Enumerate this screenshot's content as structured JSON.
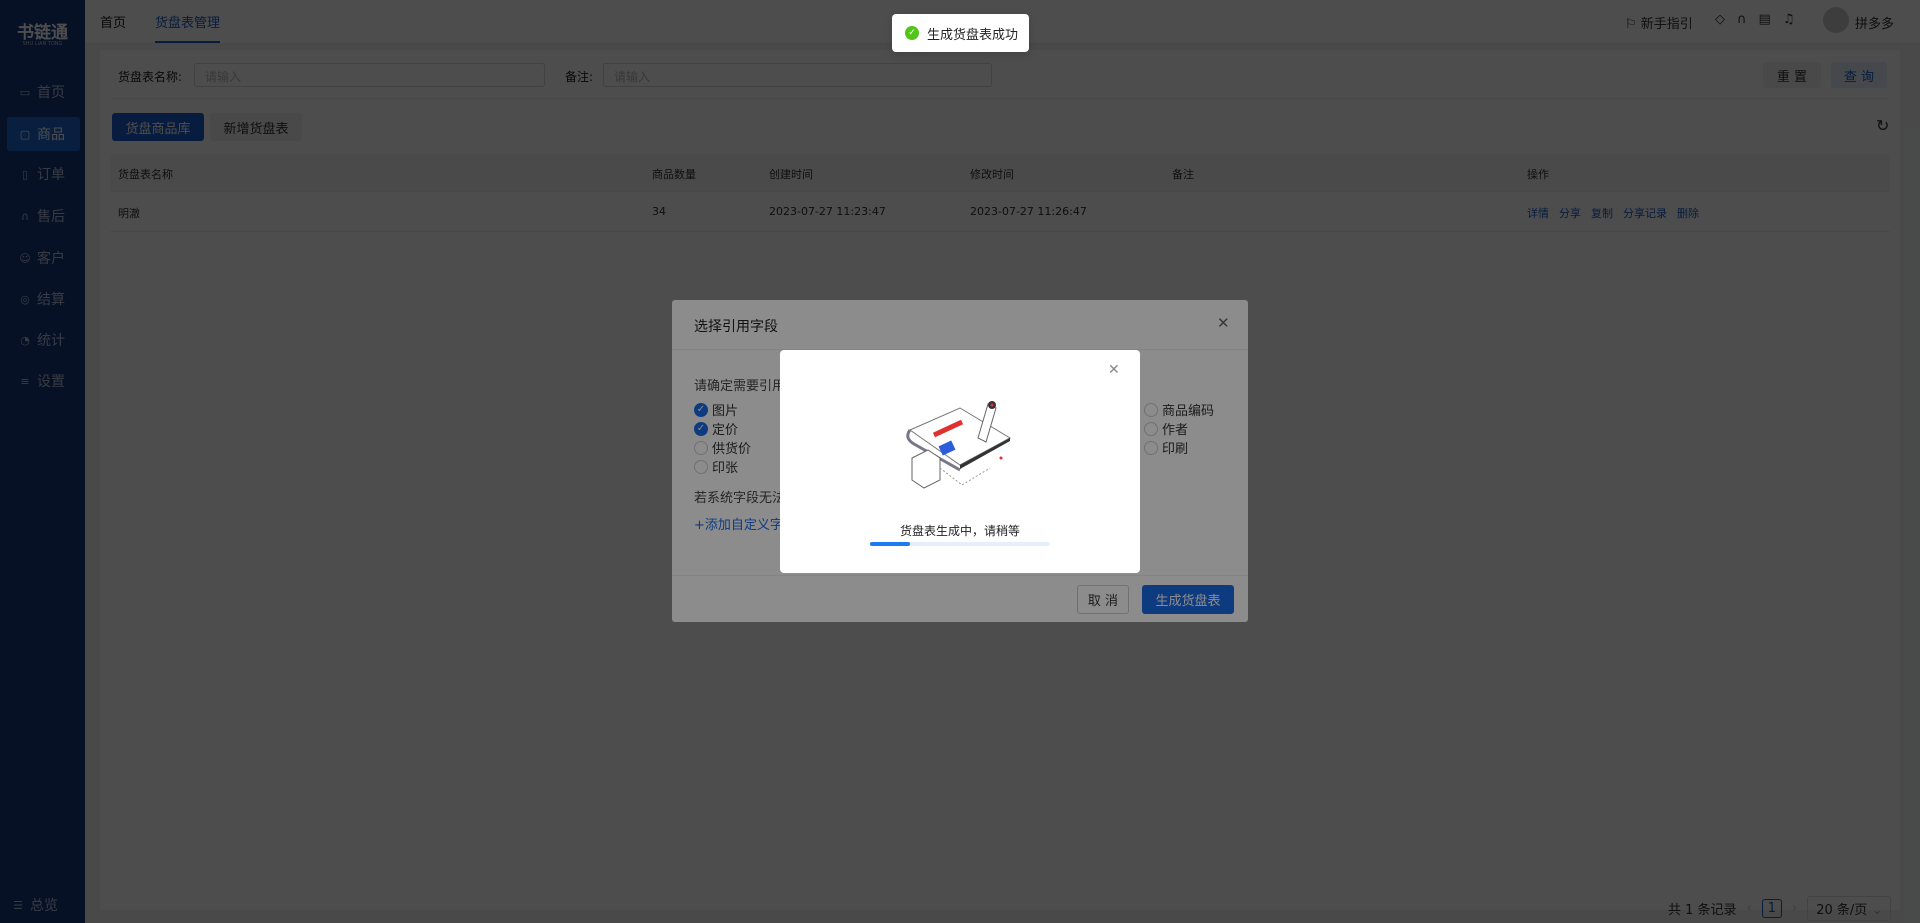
{
  "app": {
    "logo": "书链通",
    "logo_sub": "SHU LIAN TONG"
  },
  "sidebar": {
    "items": [
      {
        "label": "首页",
        "icon": "monitor-icon"
      },
      {
        "label": "商品",
        "icon": "box-icon",
        "active": true
      },
      {
        "label": "订单",
        "icon": "document-icon"
      },
      {
        "label": "售后",
        "icon": "headset-icon"
      },
      {
        "label": "客户",
        "icon": "users-icon"
      },
      {
        "label": "结算",
        "icon": "settle-icon"
      },
      {
        "label": "统计",
        "icon": "pie-icon"
      },
      {
        "label": "设置",
        "icon": "sliders-icon"
      }
    ],
    "footer": "总览"
  },
  "header": {
    "tabs": [
      "首页",
      "货盘表管理"
    ],
    "active_tab": 1,
    "guide": "新手指引",
    "user": "拼多多"
  },
  "search": {
    "name_label": "货盘表名称:",
    "name_placeholder": "请输入",
    "note_label": "备注:",
    "note_placeholder": "请输入",
    "reset": "重 置",
    "query": "查 询"
  },
  "toolbar": {
    "library": "货盘商品库",
    "add": "新增货盘表"
  },
  "table": {
    "columns": [
      "货盘表名称",
      "商品数量",
      "创建时间",
      "修改时间",
      "备注",
      "操作"
    ],
    "rows": [
      {
        "name": "明澈",
        "count": "34",
        "created": "2023-07-27 11:23:47",
        "modified": "2023-07-27 11:26:47",
        "note": "",
        "actions": [
          "详情",
          "分享",
          "复制",
          "分享记录",
          "删除"
        ]
      }
    ]
  },
  "pagination": {
    "total": "共 1 条记录",
    "page": "1",
    "page_size": "20 条/页"
  },
  "dialog": {
    "title": "选择引用字段",
    "prompt": "请确定需要引用",
    "fields_left": [
      {
        "label": "图片",
        "checked": true
      },
      {
        "label": "定价",
        "checked": true
      },
      {
        "label": "供货价",
        "checked": false
      },
      {
        "label": "印张",
        "checked": false
      }
    ],
    "fields_right": [
      {
        "label": "商品编码",
        "checked": false
      },
      {
        "label": "作者",
        "checked": false
      },
      {
        "label": "印刷",
        "checked": false
      }
    ],
    "hint": "若系统字段无法",
    "add_custom": "+添加自定义字",
    "cancel": "取 消",
    "submit": "生成货盘表"
  },
  "progress_modal": {
    "message": "货盘表生成中，请稍等",
    "progress": 0.22
  },
  "toast": {
    "message": "生成货盘表成功",
    "status": "success",
    "color": "#52c41a"
  }
}
